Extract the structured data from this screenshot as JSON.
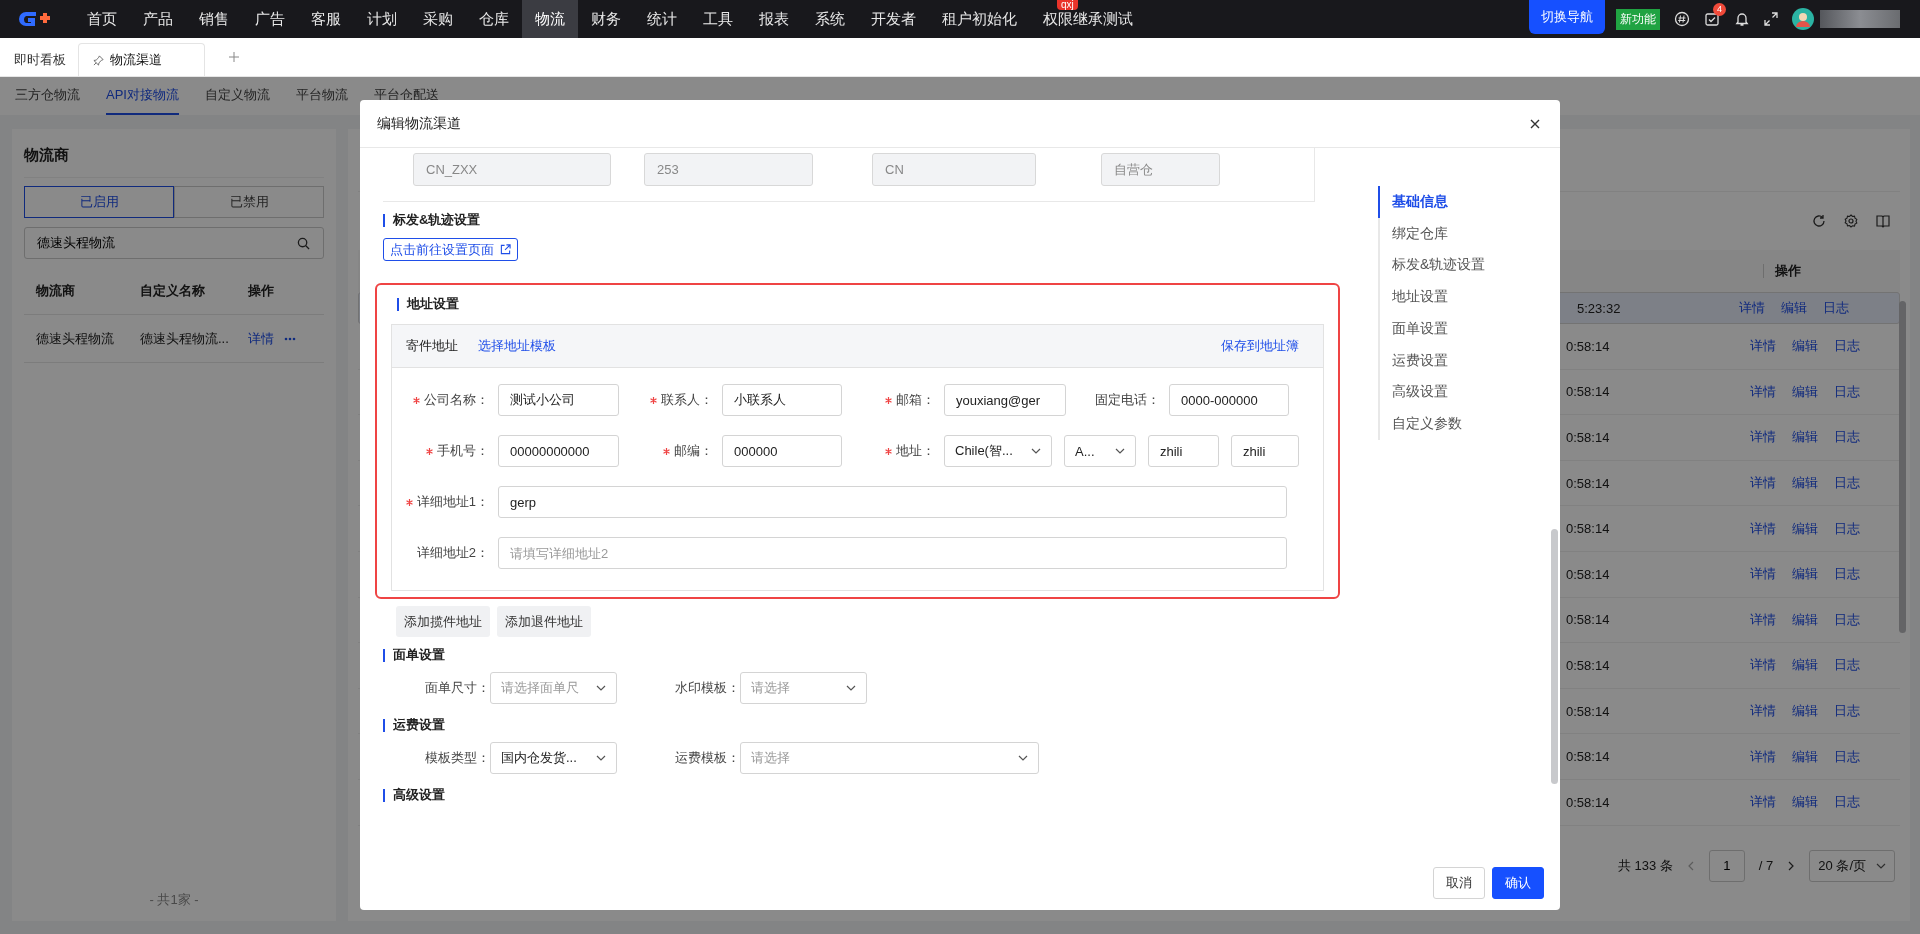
{
  "top_nav": {
    "menu": [
      {
        "label": "首页",
        "selected": false
      },
      {
        "label": "产品",
        "selected": false
      },
      {
        "label": "销售",
        "selected": false
      },
      {
        "label": "广告",
        "selected": false
      },
      {
        "label": "客服",
        "selected": false
      },
      {
        "label": "计划",
        "selected": false
      },
      {
        "label": "采购",
        "selected": false
      },
      {
        "label": "仓库",
        "selected": false
      },
      {
        "label": "物流",
        "selected": true
      },
      {
        "label": "财务",
        "selected": false
      },
      {
        "label": "统计",
        "selected": false
      },
      {
        "label": "工具",
        "selected": false
      },
      {
        "label": "报表",
        "selected": false
      },
      {
        "label": "系统",
        "selected": false
      },
      {
        "label": "开发者",
        "selected": false
      },
      {
        "label": "租户初始化",
        "selected": false
      },
      {
        "label": "权限继承测试",
        "selected": false,
        "badge": "qxj"
      }
    ],
    "switch_nav_button": "切换导航",
    "new_feature_badge": "新功能",
    "task_count": "4"
  },
  "page_tabs": [
    {
      "label": "即时看板",
      "selected": false
    },
    {
      "label": "物流渠道",
      "selected": true
    }
  ],
  "sub_tabs": [
    {
      "label": "三方仓物流",
      "selected": false
    },
    {
      "label": "API对接物流",
      "selected": true
    },
    {
      "label": "自定义物流",
      "selected": false
    },
    {
      "label": "平台物流",
      "selected": false
    },
    {
      "label": "平台仓配送",
      "selected": false
    }
  ],
  "carrier_panel": {
    "title": "物流商",
    "filters": [
      {
        "label": "已启用",
        "selected": true
      },
      {
        "label": "已禁用",
        "selected": false
      }
    ],
    "search": {
      "value": "德速头程物流"
    },
    "columns": [
      "物流商",
      "自定义名称",
      "操作"
    ],
    "rows": [
      {
        "carrier": "德速头程物流",
        "custom_name": "德速头程物流...",
        "action": "详情"
      }
    ],
    "footer": "- 共1家 -"
  },
  "channel_table": {
    "action_header": "操作",
    "rows": [
      {
        "time": "5:23:32",
        "selected": true,
        "actions": [
          "详情",
          "编辑",
          "日志"
        ]
      },
      {
        "time": "0:58:14",
        "selected": false,
        "actions": [
          "详情",
          "编辑",
          "日志"
        ]
      },
      {
        "time": "0:58:14",
        "selected": false,
        "actions": [
          "详情",
          "编辑",
          "日志"
        ]
      },
      {
        "time": "0:58:14",
        "selected": false,
        "actions": [
          "详情",
          "编辑",
          "日志"
        ]
      },
      {
        "time": "0:58:14",
        "selected": false,
        "actions": [
          "详情",
          "编辑",
          "日志"
        ]
      },
      {
        "time": "0:58:14",
        "selected": false,
        "actions": [
          "详情",
          "编辑",
          "日志"
        ]
      },
      {
        "time": "0:58:14",
        "selected": false,
        "actions": [
          "详情",
          "编辑",
          "日志"
        ]
      },
      {
        "time": "0:58:14",
        "selected": false,
        "actions": [
          "详情",
          "编辑",
          "日志"
        ]
      },
      {
        "time": "0:58:14",
        "selected": false,
        "actions": [
          "详情",
          "编辑",
          "日志"
        ]
      },
      {
        "time": "0:58:14",
        "selected": false,
        "actions": [
          "详情",
          "编辑",
          "日志"
        ]
      },
      {
        "time": "0:58:14",
        "selected": false,
        "actions": [
          "详情",
          "编辑",
          "日志"
        ]
      },
      {
        "time": "0:58:14",
        "selected": false,
        "actions": [
          "详情",
          "编辑",
          "日志"
        ]
      }
    ],
    "pagination": {
      "total": "共 133 条",
      "page": "1",
      "pages": "/ 7",
      "page_size": "20 条/页"
    }
  },
  "modal": {
    "title": "编辑物流渠道",
    "basic_values": [
      "CN_ZXX",
      "253",
      "CN",
      "自营仓"
    ],
    "tracking_section": {
      "title": "标发&轨迹设置",
      "link": "点击前往设置页面"
    },
    "address_section": {
      "title": "地址设置",
      "highlighted": true,
      "panel_title": "寄件地址",
      "template_link": "选择地址模板",
      "save_link": "保存到地址簿",
      "rows": [
        {
          "fields": [
            {
              "kind": "input",
              "label": "公司名称：",
              "required": true,
              "value": "测试小公司"
            },
            {
              "kind": "input",
              "label": "联系人：",
              "required": true,
              "value": "小联系人"
            },
            {
              "kind": "input",
              "label": "邮箱：",
              "required": true,
              "value": "youxiang@ger"
            },
            {
              "kind": "input",
              "label": "固定电话：",
              "required": false,
              "value": "0000-000000"
            }
          ]
        },
        {
          "fields": [
            {
              "kind": "input",
              "label": "手机号：",
              "required": true,
              "value": "00000000000"
            },
            {
              "kind": "input",
              "label": "邮编：",
              "required": true,
              "value": "000000"
            },
            {
              "kind": "address",
              "label": "地址：",
              "required": true,
              "parts": [
                {
                  "kind": "select",
                  "value": "Chile(智..."
                },
                {
                  "kind": "select",
                  "value": "A..."
                },
                {
                  "kind": "input",
                  "value": "zhili"
                },
                {
                  "kind": "input",
                  "value": "zhili"
                }
              ]
            }
          ]
        },
        {
          "fields": [
            {
              "kind": "wide",
              "label": "详细地址1：",
              "required": true,
              "value": "gerp"
            }
          ]
        },
        {
          "fields": [
            {
              "kind": "wide",
              "label": "详细地址2：",
              "required": false,
              "placeholder": "请填写详细地址2"
            }
          ]
        }
      ],
      "buttons": [
        "添加揽件地址",
        "添加退件地址"
      ]
    },
    "label_section": {
      "title": "面单设置",
      "fields": [
        {
          "kind": "select",
          "label": "面单尺寸：",
          "placeholder": "请选择面单尺"
        },
        {
          "kind": "select",
          "label": "水印模板：",
          "placeholder": "请选择"
        }
      ]
    },
    "freight_section": {
      "title": "运费设置",
      "fields": [
        {
          "kind": "select",
          "label": "模板类型：",
          "value": "国内仓发货..."
        },
        {
          "kind": "wide_select",
          "label": "运费模板：",
          "placeholder": "请选择"
        }
      ]
    },
    "advanced_section": {
      "title": "高级设置"
    },
    "anchor_nav": [
      {
        "label": "基础信息",
        "selected": true
      },
      {
        "label": "绑定仓库",
        "selected": false
      },
      {
        "label": "标发&轨迹设置",
        "selected": false
      },
      {
        "label": "地址设置",
        "selected": false
      },
      {
        "label": "面单设置",
        "selected": false
      },
      {
        "label": "运费设置",
        "selected": false
      },
      {
        "label": "高级设置",
        "selected": false
      },
      {
        "label": "自定义参数",
        "selected": false
      }
    ],
    "footer": {
      "cancel": "取消",
      "confirm": "确认"
    }
  }
}
